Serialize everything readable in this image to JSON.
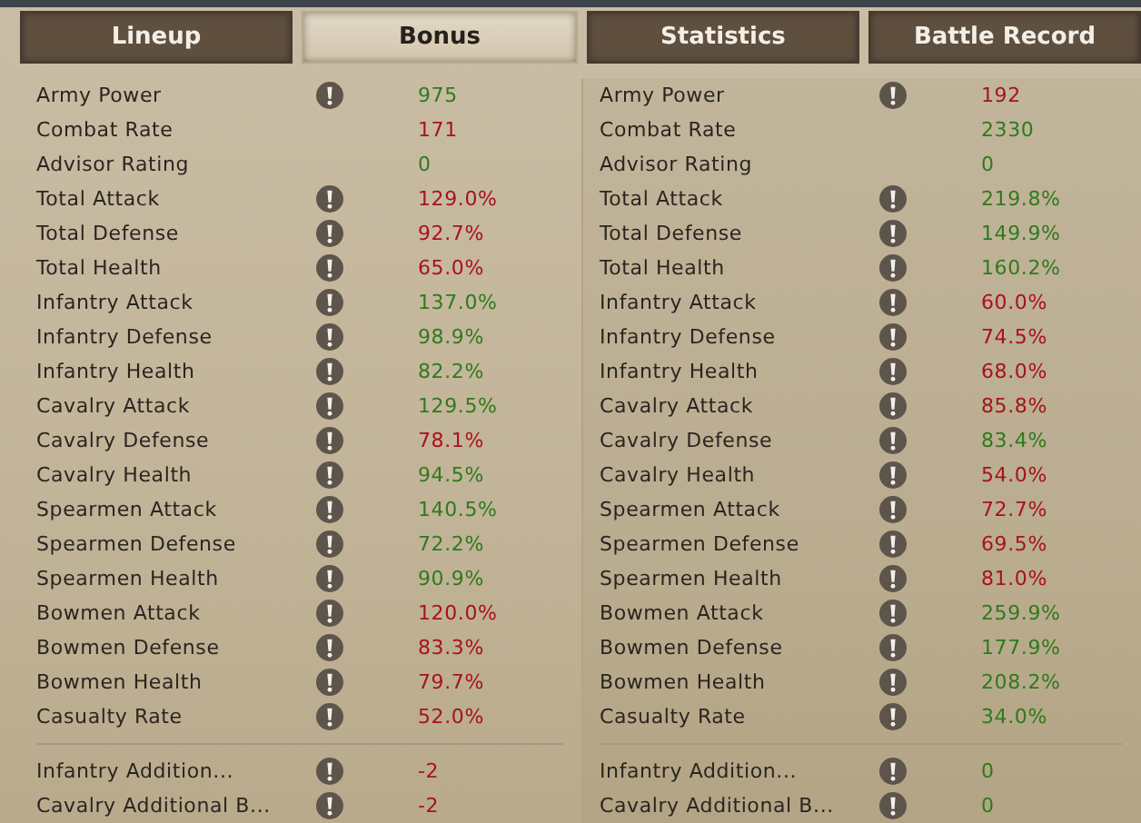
{
  "tabs": [
    {
      "label": "Lineup",
      "selected": false
    },
    {
      "label": "Bonus",
      "selected": true
    },
    {
      "label": "Statistics",
      "selected": false
    },
    {
      "label": "Battle Record",
      "selected": false
    }
  ],
  "panels": [
    {
      "groups": [
        {
          "rows": [
            {
              "label": "Army Power",
              "info": true,
              "value": "975",
              "color": "#2f7a1c"
            },
            {
              "label": "Combat Rate",
              "info": false,
              "value": "171",
              "color": "#a8121c"
            },
            {
              "label": "Advisor Rating",
              "info": false,
              "value": "0",
              "color": "#2f7a1c"
            },
            {
              "label": "Total Attack",
              "info": true,
              "value": "129.0%",
              "color": "#a8121c"
            },
            {
              "label": "Total Defense",
              "info": true,
              "value": "92.7%",
              "color": "#a8121c"
            },
            {
              "label": "Total Health",
              "info": true,
              "value": "65.0%",
              "color": "#a8121c"
            },
            {
              "label": "Infantry Attack",
              "info": true,
              "value": "137.0%",
              "color": "#2f7a1c"
            },
            {
              "label": "Infantry Defense",
              "info": true,
              "value": "98.9%",
              "color": "#2f7a1c"
            },
            {
              "label": "Infantry Health",
              "info": true,
              "value": "82.2%",
              "color": "#2f7a1c"
            },
            {
              "label": "Cavalry Attack",
              "info": true,
              "value": "129.5%",
              "color": "#2f7a1c"
            },
            {
              "label": "Cavalry Defense",
              "info": true,
              "value": "78.1%",
              "color": "#a8121c"
            },
            {
              "label": "Cavalry Health",
              "info": true,
              "value": "94.5%",
              "color": "#2f7a1c"
            },
            {
              "label": "Spearmen Attack",
              "info": true,
              "value": "140.5%",
              "color": "#2f7a1c"
            },
            {
              "label": "Spearmen Defense",
              "info": true,
              "value": "72.2%",
              "color": "#2f7a1c"
            },
            {
              "label": "Spearmen Health",
              "info": true,
              "value": "90.9%",
              "color": "#2f7a1c"
            },
            {
              "label": "Bowmen Attack",
              "info": true,
              "value": "120.0%",
              "color": "#a8121c"
            },
            {
              "label": "Bowmen Defense",
              "info": true,
              "value": "83.3%",
              "color": "#a8121c"
            },
            {
              "label": "Bowmen Health",
              "info": true,
              "value": "79.7%",
              "color": "#a8121c"
            },
            {
              "label": "Casualty Rate",
              "info": true,
              "value": "52.0%",
              "color": "#a8121c"
            }
          ]
        },
        {
          "rows": [
            {
              "label": "Infantry Addition...",
              "info": true,
              "value": "-2",
              "color": "#a8121c"
            },
            {
              "label": "Cavalry Additional B...",
              "info": true,
              "value": "-2",
              "color": "#a8121c"
            }
          ]
        }
      ]
    },
    {
      "groups": [
        {
          "rows": [
            {
              "label": "Army Power",
              "info": true,
              "value": "192",
              "color": "#a8121c"
            },
            {
              "label": "Combat Rate",
              "info": false,
              "value": "2330",
              "color": "#2f7a1c"
            },
            {
              "label": "Advisor Rating",
              "info": false,
              "value": "0",
              "color": "#2f7a1c"
            },
            {
              "label": "Total Attack",
              "info": true,
              "value": "219.8%",
              "color": "#2f7a1c"
            },
            {
              "label": "Total Defense",
              "info": true,
              "value": "149.9%",
              "color": "#2f7a1c"
            },
            {
              "label": "Total Health",
              "info": true,
              "value": "160.2%",
              "color": "#2f7a1c"
            },
            {
              "label": "Infantry Attack",
              "info": true,
              "value": "60.0%",
              "color": "#a8121c"
            },
            {
              "label": "Infantry Defense",
              "info": true,
              "value": "74.5%",
              "color": "#a8121c"
            },
            {
              "label": "Infantry Health",
              "info": true,
              "value": "68.0%",
              "color": "#a8121c"
            },
            {
              "label": "Cavalry Attack",
              "info": true,
              "value": "85.8%",
              "color": "#a8121c"
            },
            {
              "label": "Cavalry Defense",
              "info": true,
              "value": "83.4%",
              "color": "#2f7a1c"
            },
            {
              "label": "Cavalry Health",
              "info": true,
              "value": "54.0%",
              "color": "#a8121c"
            },
            {
              "label": "Spearmen Attack",
              "info": true,
              "value": "72.7%",
              "color": "#a8121c"
            },
            {
              "label": "Spearmen Defense",
              "info": true,
              "value": "69.5%",
              "color": "#a8121c"
            },
            {
              "label": "Spearmen Health",
              "info": true,
              "value": "81.0%",
              "color": "#a8121c"
            },
            {
              "label": "Bowmen Attack",
              "info": true,
              "value": "259.9%",
              "color": "#2f7a1c"
            },
            {
              "label": "Bowmen Defense",
              "info": true,
              "value": "177.9%",
              "color": "#2f7a1c"
            },
            {
              "label": "Bowmen Health",
              "info": true,
              "value": "208.2%",
              "color": "#2f7a1c"
            },
            {
              "label": "Casualty Rate",
              "info": true,
              "value": "34.0%",
              "color": "#2f7a1c"
            }
          ]
        },
        {
          "rows": [
            {
              "label": "Infantry Addition...",
              "info": true,
              "value": "0",
              "color": "#2f7a1c"
            },
            {
              "label": "Cavalry Additional B...",
              "info": true,
              "value": "0",
              "color": "#2f7a1c"
            }
          ]
        }
      ]
    }
  ]
}
